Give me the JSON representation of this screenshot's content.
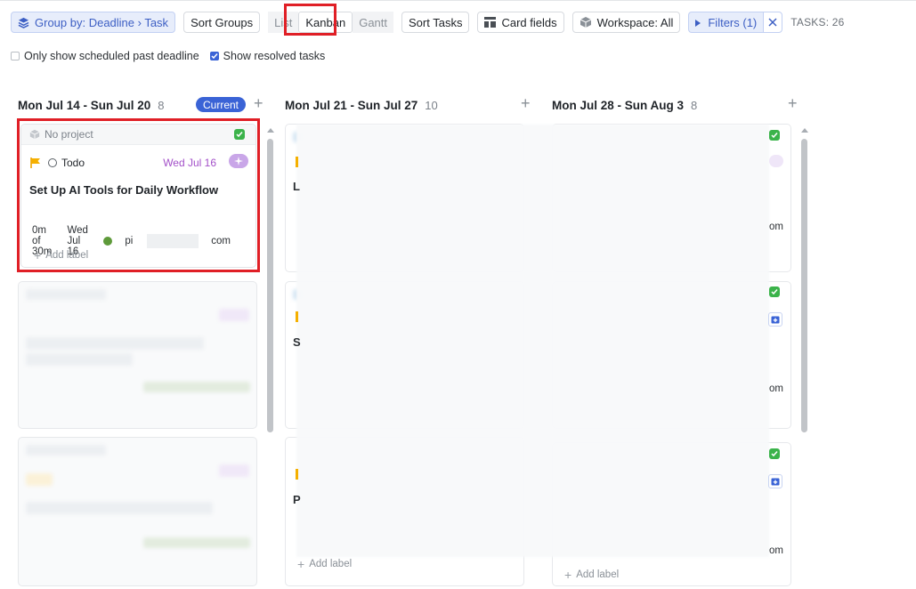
{
  "toolbar": {
    "group_by": "Group by: Deadline › Task",
    "sort_groups": "Sort Groups",
    "views": [
      "List",
      "Kanban",
      "Gantt"
    ],
    "active_view": "Kanban",
    "sort_tasks": "Sort Tasks",
    "card_fields": "Card fields",
    "workspace": "Workspace: All",
    "filters": "Filters (1)",
    "tasks_count": "TASKS: 26"
  },
  "options": {
    "only_scheduled": {
      "label": "Only show scheduled past deadline",
      "checked": false
    },
    "show_resolved": {
      "label": "Show resolved tasks",
      "checked": true
    }
  },
  "columns": [
    {
      "title": "Mon Jul 14 - Sun Jul 20",
      "count": "8",
      "badge": "Current"
    },
    {
      "title": "Mon Jul 21 - Sun Jul 27",
      "count": "10"
    },
    {
      "title": "Mon Jul 28 - Sun Aug 3",
      "count": "8"
    }
  ],
  "featured_card": {
    "project": "No project",
    "status": "Todo",
    "due": "Wed Jul 16",
    "title": "Set Up AI Tools for Daily Workflow",
    "time": "0m of 30m",
    "date": "Wed Jul 16",
    "assignee_prefix": "pi",
    "assignee_suffix": "com",
    "add_label": "Add label"
  },
  "col2_add_label": "Add label",
  "col3_add_label": "Add label",
  "col3_suffix": "om",
  "colors": {
    "accent": "#3a63d6",
    "due_purple": "#a350c9",
    "highlight_red": "#e01f26",
    "status_green": "#3bb34a"
  }
}
